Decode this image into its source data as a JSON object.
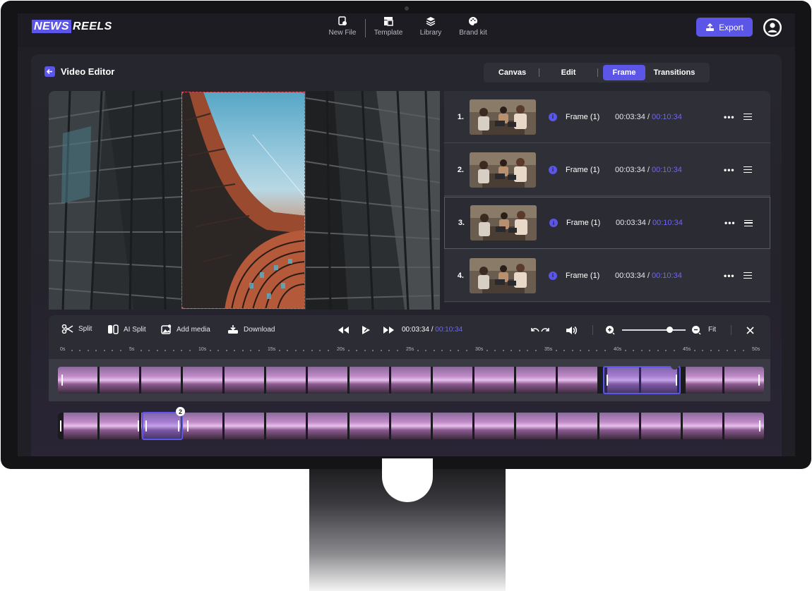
{
  "app": {
    "logo_part1": "NEWS",
    "logo_part2": "REELS"
  },
  "nav": [
    {
      "label": "New File",
      "icon": "new-file-icon"
    },
    {
      "label": "Template",
      "icon": "template-icon"
    },
    {
      "label": "Library",
      "icon": "library-icon"
    },
    {
      "label": "Brand kit",
      "icon": "palette-icon"
    }
  ],
  "header": {
    "export_label": "Export",
    "avatar_icon": "user-avatar-icon"
  },
  "editor": {
    "title": "Video Editor",
    "tabs": [
      {
        "label": "Canvas",
        "active": false
      },
      {
        "label": "Edit",
        "active": false
      },
      {
        "label": "Frame",
        "active": true
      },
      {
        "label": "Transitions",
        "active": false
      }
    ]
  },
  "frames": [
    {
      "num": "1.",
      "name": "Frame (1)",
      "time": "00:03:34",
      "sep": "/",
      "total": "00:10:34",
      "selected": false
    },
    {
      "num": "2.",
      "name": "Frame (1)",
      "time": "00:03:34",
      "sep": "/",
      "total": "00:10:34",
      "selected": false
    },
    {
      "num": "3.",
      "name": "Frame (1)",
      "time": "00:03:34",
      "sep": "/",
      "total": "00:10:34",
      "selected": true
    },
    {
      "num": "4.",
      "name": "Frame (1)",
      "time": "00:03:34",
      "sep": "/",
      "total": "00:10:34",
      "selected": false
    }
  ],
  "toolbar": {
    "split": "Split",
    "ai_split": "AI Split",
    "add_media": "Add media",
    "download": "Download",
    "current_time": "00:03:34",
    "time_sep": "/",
    "total_time": "00:10:34",
    "fit": "Fit",
    "zoom_level": 0.75
  },
  "ruler": {
    "labels": [
      "0s",
      "5s",
      "10s",
      "15s",
      "20s",
      "25s",
      "30s",
      "35s",
      "40s",
      "45s",
      "50s"
    ]
  },
  "timeline": {
    "track2_badge": "2"
  },
  "colors": {
    "accent": "#5b55e8",
    "accent_text": "#6e68f0",
    "crop_border": "#e0415e"
  }
}
